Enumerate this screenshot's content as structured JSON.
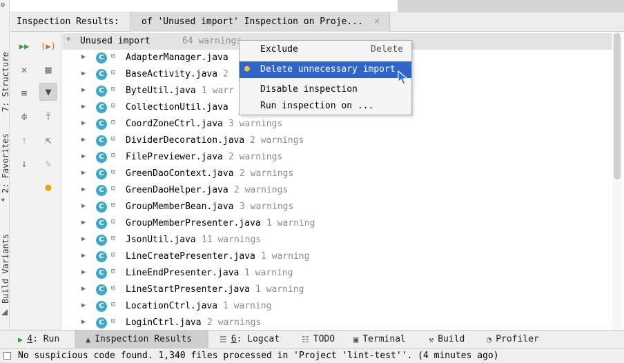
{
  "side_strip": {
    "structure": "7: Structure",
    "favorites": "2: Favorites",
    "build_variants": "Build Variants"
  },
  "header": {
    "title": "Inspection Results:",
    "tab_label": "of 'Unused import' Inspection on Proje...",
    "tab_close": "×"
  },
  "tree": {
    "root_label": "Unused import",
    "root_count": "64 warnings",
    "files": [
      {
        "name": "AdapterManager.java",
        "warnings": ""
      },
      {
        "name": "BaseActivity.java",
        "warnings": "2"
      },
      {
        "name": "ByteUtil.java",
        "warnings": "1 warr"
      },
      {
        "name": "CollectionUtil.java",
        "warnings": ""
      },
      {
        "name": "CoordZoneCtrl.java",
        "warnings": "3 warnings"
      },
      {
        "name": "DividerDecoration.java",
        "warnings": "2 warnings"
      },
      {
        "name": "FilePreviewer.java",
        "warnings": "2 warnings"
      },
      {
        "name": "GreenDaoContext.java",
        "warnings": "2 warnings"
      },
      {
        "name": "GreenDaoHelper.java",
        "warnings": "2 warnings"
      },
      {
        "name": "GroupMemberBean.java",
        "warnings": "3 warnings"
      },
      {
        "name": "GroupMemberPresenter.java",
        "warnings": "1 warning"
      },
      {
        "name": "JsonUtil.java",
        "warnings": "11 warnings"
      },
      {
        "name": "LineCreatePresenter.java",
        "warnings": "1 warning"
      },
      {
        "name": "LineEndPresenter.java",
        "warnings": "1 warning"
      },
      {
        "name": "LineStartPresenter.java",
        "warnings": "1 warning"
      },
      {
        "name": "LocationCtrl.java",
        "warnings": "1 warning"
      },
      {
        "name": "LoginCtrl.java",
        "warnings": "2 warnings"
      }
    ]
  },
  "context_menu": {
    "items": [
      {
        "label": "Exclude",
        "shortcut": "Delete"
      },
      {
        "label": "Delete unnecessary import",
        "shortcut": ""
      },
      {
        "label": "Disable inspection",
        "shortcut": ""
      },
      {
        "label": "Run inspection on ...",
        "shortcut": ""
      }
    ]
  },
  "bottom_tools": [
    {
      "prefix": "4",
      "label": ": Run"
    },
    {
      "prefix": "",
      "label": "Inspection Results"
    },
    {
      "prefix": "6",
      "label": ": Logcat"
    },
    {
      "prefix": "",
      "label": "TODO"
    },
    {
      "prefix": "",
      "label": "Terminal"
    },
    {
      "prefix": "",
      "label": "Build"
    },
    {
      "prefix": "",
      "label": "Profiler"
    }
  ],
  "status": {
    "message": "No suspicious code found. 1,340 files processed in 'Project 'lint-test''. (4 minutes ago)"
  },
  "colors": {
    "selection": "#2f65ca",
    "class_icon": "#3fa8c6",
    "muted_text": "#8c8c8c"
  }
}
